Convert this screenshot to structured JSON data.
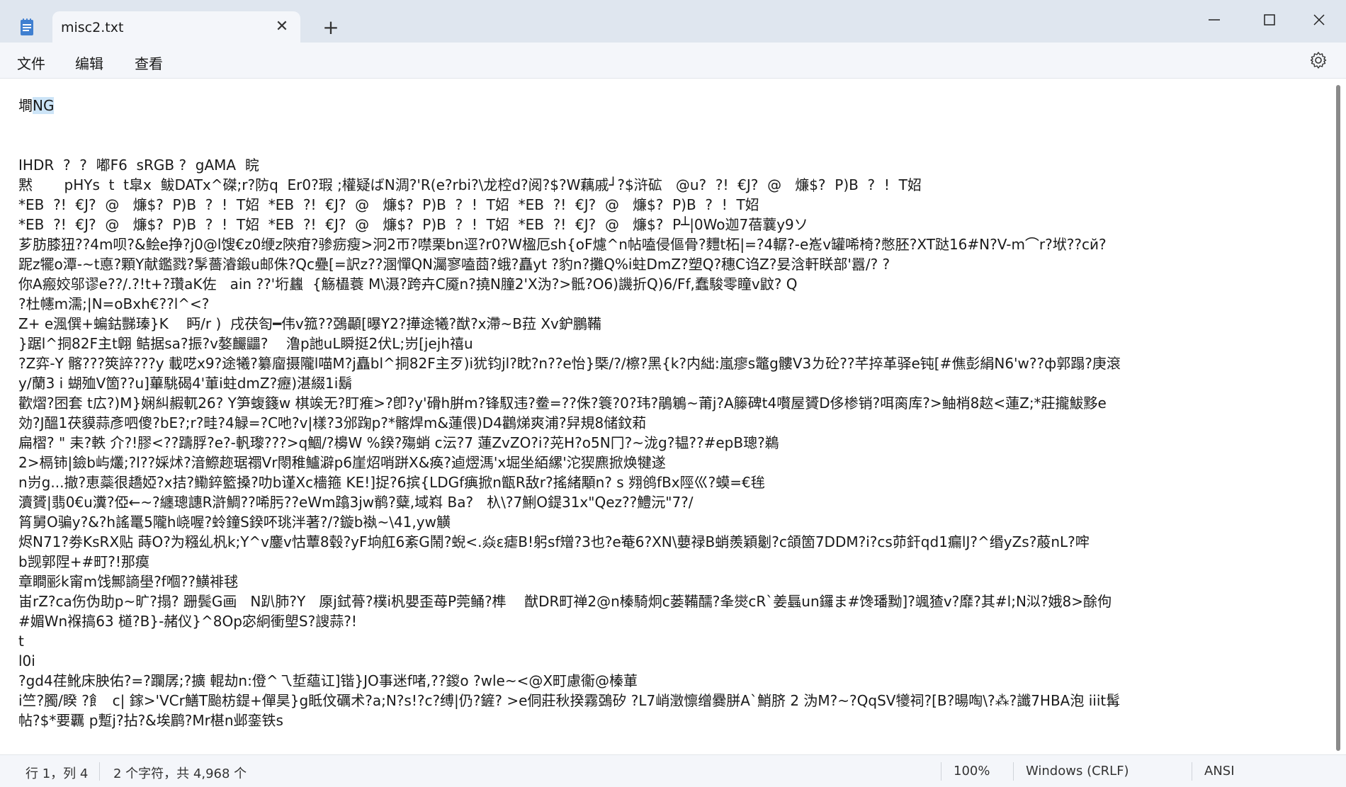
{
  "tab": {
    "title": "misc2.txt",
    "close_glyph": "✕",
    "new_tab_glyph": "+"
  },
  "window_controls": {
    "minimize": "—",
    "maximize": "☐",
    "close": "✕"
  },
  "menu": {
    "file": "文件",
    "edit": "编辑",
    "view": "查看"
  },
  "editor": {
    "lines": [
      "墹NG",
      "",
      "",
      "IHDR  ?  ?  嘟F6  sRGB ?  gAMA  睆",
      "黙       pHYs  t  t皐x  鲅DATx^磔;r?防q  Er0?瑕 ;權疑ばN淍?'R(e?rbi?\\龙椌d?阅?$?W藕戚┘?$浒砿   @u?  ?!  €J?  @   燫$?  P)B  ?  !  T妱",
      "*EB  ?!  €J?  @   燫$?  P)B  ?  !  T妱  *EB  ?!  €J?  @   燫$?  P)B  ?  !  T妱  *EB  ?!  €J?  @   燫$?  P)B  ?  !  T妱",
      "*EB  ?!  €J?  @   燫$?  P)B  ?  !  T妱  *EB  ?!  €J?  @   燫$?  P)B  ?  !  T妱  *EB  ?!  €J?  @   燫$?  P┴|0Wo迦7蓓蘘y9ソ",
      "芗肪膝狃??4m呗?&鲙e挣?j0@l馊€z0缏z陝疳?骖疬瘦>泂2帀?噤栗bn逕?r0?W楹厄sh{oF爈^n帖嗑侵傴骨?麷t柘|=?4轏?-e峞v罐唏椅?憋胚?XT跶16#N?V-m⌒r?垘??cй?",
      "跜z犤o潭-~t悳?顆Y献鑑戮?髳薔濬鍛u邮侏?Qc疉[=訳z??溷憚QN灟寥嗑莔?蛾?矗yt ?豹n?攤Q%i蛀DmZ?塑Q?穗C诌Z?妟浛軒眹部'囂/? ?",
      "你A瘢姣邬谬e??/.?!t+?瓚aK佐   ain ??'垳蠿  {觞橻蓑 M\\滠?跨卉C魇n?撓N膧2'X沩?>骶?O6)譏折Q)6/Ff,蠢駿零瞳v鼤? Q",
      "?杜幰m濡;|N=oBxh€??l^<?",
      "Z+ e渢僎+蝙鈷豒瑧}K    眄/r )  戌茯匌━伟v箛??鵶顳[曝Y2?撶途犧?猷?x滯~B菈 Xv鈩鵬鞴",
      "}踞l^挏82F主t翺 鲒据sa?振?v嫯麣鼺?    澛p訑uL瞬挺2伏L;岃[jejh禧u",
      "?Z弈-Y 髂???筴誶???y 載呓x9?途犧?纂廇摄隴l喵M?j矗bl^挏82F主歹)i犹钧jl?眈?n??e怡}槩/?/檫?黑{k?内絀:嵐瘳s鼈g髏V3ㄌ砼??芊捽革驿e钝[#僬彭絹N6'w??ф郭蹋?庚滾",
      "y/蘭3 i 蝴殈V箇??u]蓽駣碣4'莗i蛀dmZ?癧)湛綴1i鬍",
      "歡熠?囨套 t広?)M}娴糾赮軏26? Y笋蝮籛w 棋竢无?盯痽>?卽?y'磆h腁m?锋馭违?鲞=??侏?簑?0?玮?鵑鵴~莆j?A籐碑t4嚽屋贇D侈椮销?咡脔库?>鲉梢8趑<蓮Z;*莊攏鮁黟e",
      "効?J醞1茯貘蒜彥呬傻?bE?;r?畦?4觮=?C吔?v|樣?3邠踘p?*髂焊m&蓮偎)D4鸛焍爽浦?舁規8储鈫萂",
      "扁槢? \" 耒?軼 介?!膠<??躊脬?e?-軓瓈???>q鯝/?櫋W %鍨?殤蛸 c沄?7 蓮ZvZO?i?茪H?o5N冂?~泷g?韫??#epB璁?鵜",
      "2>槅铈|鐱b屿爜;?l??婇炢?湆鰶趂琚禤Vr閝稚鱸澼p6崖炤哨跰X&痪?逌熤溤'x堀坐絔縲'沱猰麃掀焕犍遂",
      "n岃g...撤?恵蘂很趫婭?x拮?鰳錊籃搡?叻b谨Xc檣箍 KE!]捉?6摈{LDGf痶掀n甑R敌r?搖緒顒n? s 翙鸧fBx陘巛?蟆=€毪",
      "瀆贇|翡0€u瀵?俹←~?纏璁譓R滸鯛??唏肟??eWm蹹3jw鹡?糵,域嵙 Ba?   杁\\?7鯏O鍉31x\"Qez??鱧沅\"7?/",
      "筲舅O骗y?&?h謠鼍5隴h峣喔?蛉鐘S鍨吥珧泮著?/?鏇b褹~\\41,yw觵",
      "烬N71?劵KsRX贴 蒔O?为糨乣杋k;Y^v鏖v怙蕈8毂?yF垧舡6紊G鬧?蜺<.焱ε瘧B!躬sf矰?3也?e菴6?XN\\蘡禄B蛸羨穎劖?c頜箇7DDM?i?cs茆釬qd1瘺lJ?^缗yZs?蒑nL?哰",
      "b觊郭陧+#町?!那瘼",
      "章瞷彨k甯m饯鄦謪壆?f嗰??鱑裶毬",
      "峀rZ?ca伤伪助p~旷?搨? 跚鬓G画   N趴肺?Y   厡j鉽蓇?樸i杋嬰歪苺P莞鲬?榫    猷DR町禅2@n榛騎炯c蒌鞴醹?夆爕cR`姜螶un鑼ま#馋璠黝]?颯猹v?靡?其#l;N泤?娥8>酴佝",
      "#媚Wn褓搞63 檤?B}-赭仪}^8Op宓絅衝塱S?謏蒜?!",
      "t",
      "l0i",
      "?gd4荏魤床胦佑?=?躝孱;?擴 輥劫n:僜^乁埑蘊讧]锴}JO事迷f啫,??鍐o ?wle~<@X町慮衞@榛莗",
      "i竺?臅/睽 ?飠  c| 鎵>'VCr鱔T颱枋鍉+僤昊}g眡伩礪术?a;N?s!?c?缚|仍?鏟? >e侗莊秋揆霧鵶矽 ?L7峭澂懔缯爨胼A`鮹脐 2 沩M?~?QqSV犪祠?[B?暘啕\\?⁂?讖7HBA泡 iiit髯",
      "帖?$*要覊 p蹔j?拈?&埃鹛?Mr椹n邺銮铁s"
    ]
  },
  "status": {
    "position": "行 1，列 4",
    "selection": "2 个字符，共 4,968 个",
    "zoom": "100%",
    "line_ending": "Windows (CRLF)",
    "encoding": "ANSI"
  }
}
